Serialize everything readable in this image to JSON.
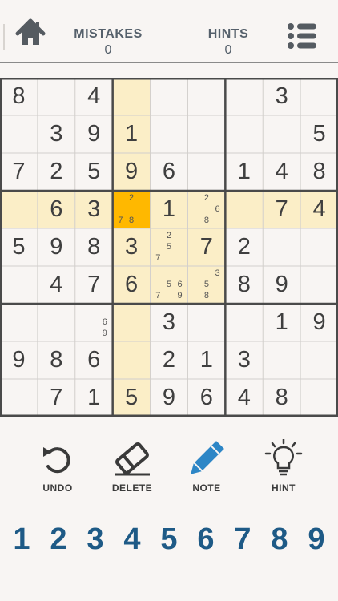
{
  "header": {
    "mistakes_label": "MISTAKES",
    "mistakes_value": "0",
    "hints_label": "HINTS",
    "hints_value": "0",
    "home_icon": "home-icon",
    "menu_icon": "list-menu-icon"
  },
  "colors": {
    "highlight": "#fbeec7",
    "selected": "#ffb800",
    "numpad": "#1e5a86",
    "note_icon": "#2d86c6"
  },
  "board": {
    "selected": [
      3,
      3
    ],
    "cells": [
      [
        "8",
        "",
        "4",
        "",
        "",
        "",
        "",
        "3",
        ""
      ],
      [
        "",
        "3",
        "9",
        "1",
        "",
        "",
        "",
        "",
        "5"
      ],
      [
        "7",
        "2",
        "5",
        "9",
        "6",
        "",
        "1",
        "4",
        "8"
      ],
      [
        "",
        "6",
        "3",
        "",
        "1",
        "",
        "",
        "7",
        "4"
      ],
      [
        "5",
        "9",
        "8",
        "3",
        "",
        "7",
        "2",
        "",
        ""
      ],
      [
        "",
        "4",
        "7",
        "6",
        "",
        "",
        "8",
        "9",
        ""
      ],
      [
        "",
        "",
        "",
        "",
        "3",
        "",
        "",
        "1",
        "9"
      ],
      [
        "9",
        "8",
        "6",
        "",
        "2",
        "1",
        "3",
        "",
        ""
      ],
      [
        "",
        "7",
        "1",
        "5",
        "9",
        "6",
        "4",
        "8",
        ""
      ]
    ],
    "notes": [
      {
        "r": 3,
        "c": 3,
        "n": [
          "2",
          "7",
          "8"
        ]
      },
      {
        "r": 3,
        "c": 5,
        "n": [
          "2",
          "6",
          "8"
        ]
      },
      {
        "r": 4,
        "c": 4,
        "n": [
          "2",
          "5",
          "7"
        ]
      },
      {
        "r": 5,
        "c": 4,
        "n": [
          "5",
          "6",
          "7",
          "9"
        ]
      },
      {
        "r": 5,
        "c": 5,
        "n": [
          "3",
          "5",
          "8"
        ]
      },
      {
        "r": 6,
        "c": 2,
        "n": [
          "6",
          "9"
        ]
      }
    ]
  },
  "tools": [
    {
      "label": "UNDO",
      "icon": "undo-icon"
    },
    {
      "label": "DELETE",
      "icon": "eraser-icon"
    },
    {
      "label": "NOTE",
      "icon": "pencil-icon"
    },
    {
      "label": "HINT",
      "icon": "lightbulb-icon"
    }
  ],
  "numpad": [
    "1",
    "2",
    "3",
    "4",
    "5",
    "6",
    "7",
    "8",
    "9"
  ]
}
